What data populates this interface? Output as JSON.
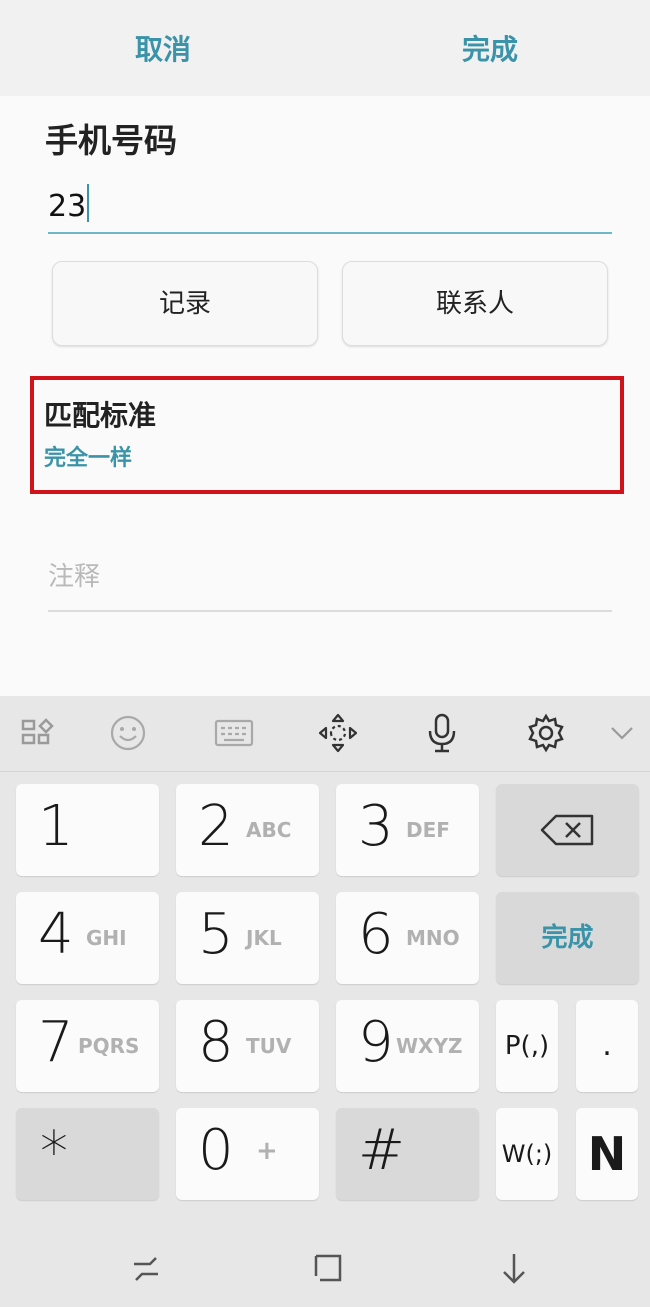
{
  "topbar": {
    "cancel": "取消",
    "done": "完成"
  },
  "form": {
    "phone_label": "手机号码",
    "phone_value": "23",
    "records_button": "记录",
    "contacts_button": "联系人",
    "match_label": "匹配标准",
    "match_value": "完全一样",
    "note_placeholder": "注释"
  },
  "keyboard": {
    "toolbar_icons": [
      "grid-icon",
      "emoji-icon",
      "keyboard-icon",
      "move-icon",
      "mic-icon",
      "settings-icon",
      "chevron-down-icon"
    ],
    "keys": [
      {
        "digit": "1",
        "letters": ""
      },
      {
        "digit": "2",
        "letters": "ABC"
      },
      {
        "digit": "3",
        "letters": "DEF"
      },
      {
        "digit": "4",
        "letters": "GHI"
      },
      {
        "digit": "5",
        "letters": "JKL"
      },
      {
        "digit": "6",
        "letters": "MNO"
      },
      {
        "digit": "7",
        "letters": "PQRS"
      },
      {
        "digit": "8",
        "letters": "TUV"
      },
      {
        "digit": "9",
        "letters": "WXYZ"
      },
      {
        "digit": "*",
        "letters": ""
      },
      {
        "digit": "0",
        "letters": "+"
      },
      {
        "digit": "#",
        "letters": ""
      }
    ],
    "done_label": "完成",
    "pause_label": "P(,)",
    "dot_label": ".",
    "wait_label": "W(;)",
    "n_label": "N",
    "accent": "#3a93a8"
  },
  "navbar": {
    "icons": [
      "recents-icon",
      "home-icon",
      "back-icon"
    ]
  }
}
